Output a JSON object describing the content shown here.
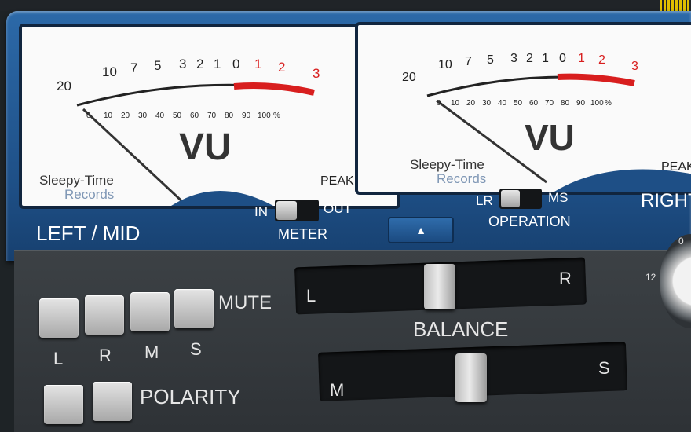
{
  "meter_left": {
    "scale_black": [
      "20",
      "10",
      "7",
      "5",
      "3",
      "2",
      "1",
      "0"
    ],
    "scale_red": [
      "1",
      "2",
      "3"
    ],
    "percent_ticks": [
      "0",
      "10",
      "20",
      "30",
      "40",
      "50",
      "60",
      "70",
      "80",
      "90",
      "100",
      "%"
    ],
    "big_label": "VU",
    "brand_line1": "Sleepy-Time",
    "brand_line2": "Records",
    "peak_label": "PEAK"
  },
  "meter_right": {
    "scale_black": [
      "20",
      "10",
      "7",
      "5",
      "3",
      "2",
      "1",
      "0"
    ],
    "scale_red": [
      "1",
      "2",
      "3"
    ],
    "percent_ticks": [
      "0",
      "10",
      "20",
      "30",
      "40",
      "50",
      "60",
      "70",
      "80",
      "90",
      "100",
      "%"
    ],
    "big_label": "VU",
    "brand_line1": "Sleepy-Time",
    "brand_line2": "Records",
    "peak_label": "PEAK"
  },
  "channel_left": "LEFT / MID",
  "channel_right": "RIGHT",
  "meter_switch": {
    "in": "IN",
    "out": "OUT",
    "title": "METER"
  },
  "operation_switch": {
    "lr": "LR",
    "ms": "MS",
    "title": "OPERATION"
  },
  "collapse_arrow": "▲",
  "mute": {
    "title": "MUTE",
    "keys": [
      "L",
      "R",
      "M",
      "S"
    ]
  },
  "polarity": {
    "title": "POLARITY"
  },
  "balance": {
    "title": "BALANCE",
    "left": "L",
    "right": "R"
  },
  "mid_side": {
    "left": "M",
    "right": "S"
  },
  "knob": {
    "tick_12": "12",
    "tick_0": "0"
  },
  "colors": {
    "panel_blue": "#2c69a8",
    "red_zone": "#d81e1e",
    "meter_face": "#fafafa"
  }
}
